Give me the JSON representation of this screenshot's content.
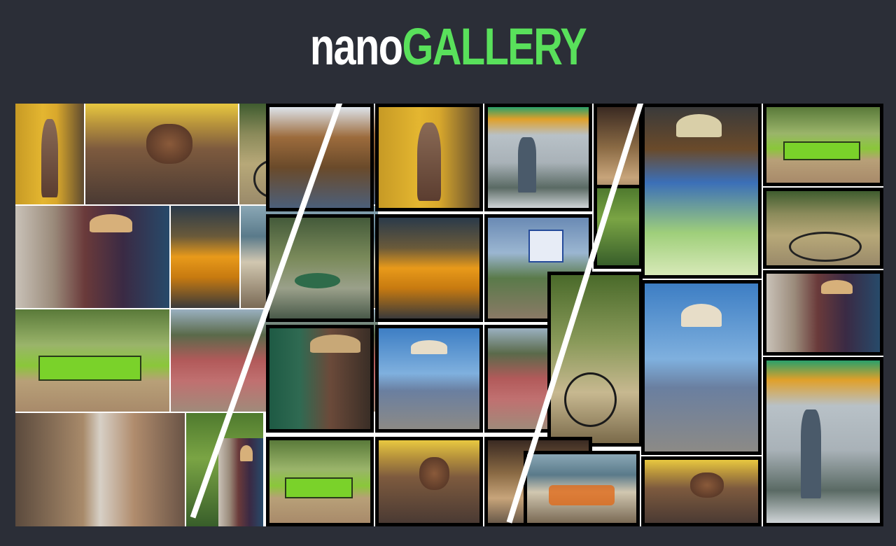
{
  "header": {
    "logo_prefix": "nano",
    "logo_suffix": "GALLERY"
  },
  "colors": {
    "background": "#2b2e37",
    "logo_accent": "#59e05b"
  },
  "gallery": {
    "section_count": 3
  }
}
